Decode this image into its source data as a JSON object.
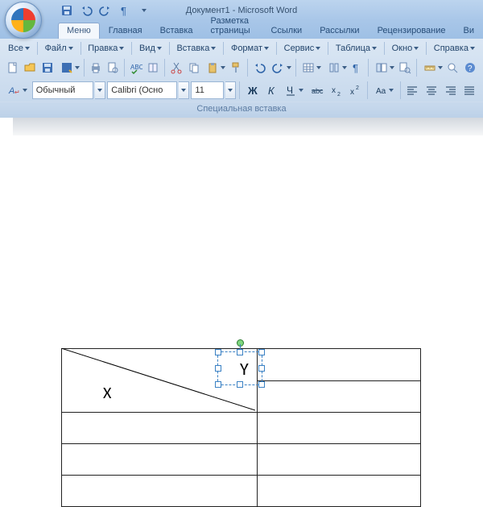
{
  "title": "Документ1 - Microsoft Word",
  "tabs": [
    "Меню",
    "Главная",
    "Вставка",
    "Разметка страницы",
    "Ссылки",
    "Рассылки",
    "Рецензирование",
    "Ви"
  ],
  "activeTab": 0,
  "menubar": [
    "Все",
    "Файл",
    "Правка",
    "Вид",
    "Вставка",
    "Формат",
    "Сервис",
    "Таблица",
    "Окно",
    "Справка"
  ],
  "style": "Обычный",
  "font": "Calibri (Осно",
  "size": "11",
  "groupLabel": "Специальная вставка",
  "doc": {
    "cellX": "X",
    "cellY": "Y"
  }
}
